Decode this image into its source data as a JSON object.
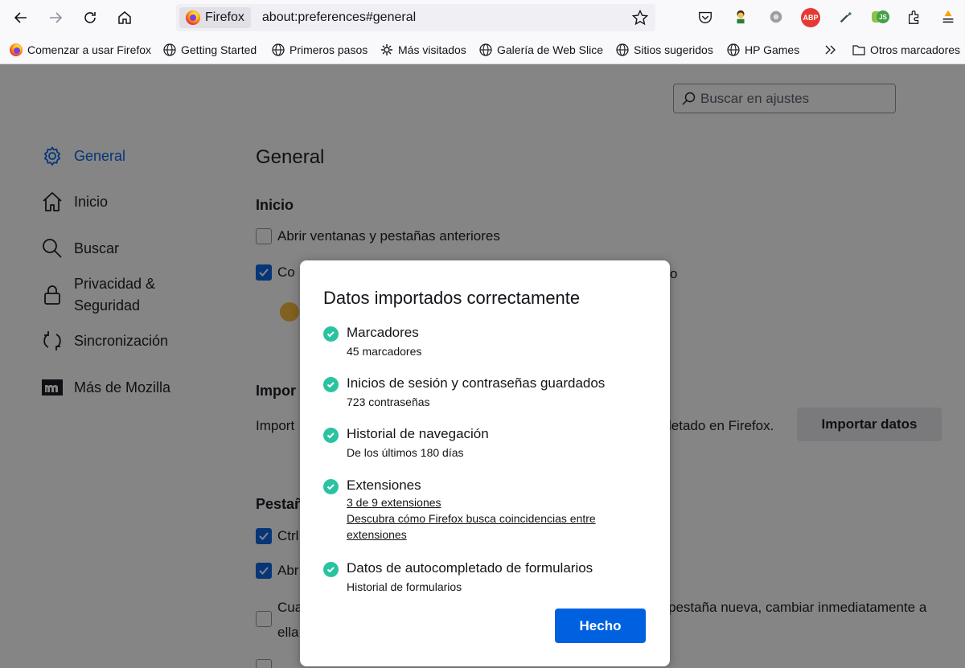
{
  "browser": {
    "identity_label": "Firefox",
    "url": "about:preferences#general"
  },
  "bookmarks": [
    {
      "label": "Comenzar a usar Firefox",
      "icon": "firefox-icon"
    },
    {
      "label": "Getting Started",
      "icon": "globe-icon"
    },
    {
      "label": "Primeros pasos",
      "icon": "globe-icon"
    },
    {
      "label": "Más visitados",
      "icon": "gear-icon"
    },
    {
      "label": "Galería de Web Slice",
      "icon": "globe-icon"
    },
    {
      "label": "Sitios sugeridos",
      "icon": "globe-icon"
    },
    {
      "label": "HP Games",
      "icon": "globe-icon"
    },
    {
      "label": "Otros marcadores",
      "icon": "folder-icon"
    }
  ],
  "toolbar_icons": {
    "abp": "ABP",
    "js": "JS"
  },
  "search": {
    "placeholder": "Buscar en ajustes"
  },
  "sidebar": {
    "items": [
      {
        "label": "General",
        "icon": "gear-icon"
      },
      {
        "label": "Inicio",
        "icon": "home-icon"
      },
      {
        "label": "Buscar",
        "icon": "search-icon"
      },
      {
        "label_line1": "Privacidad &",
        "label_line2": "Seguridad",
        "icon": "lock-icon"
      },
      {
        "label": "Sincronización",
        "icon": "sync-icon"
      },
      {
        "label": "Más de Mozilla",
        "icon": "mozilla-icon"
      }
    ]
  },
  "pane": {
    "title": "General",
    "inicio_heading": "Inicio",
    "restore_label": "Abrir ventanas y pestañas anteriores",
    "partial_checkbox_text": "Co",
    "partial_right_text": "o",
    "import_heading": "Impor",
    "import_text_left": "Import",
    "import_text_right": "letado en Firefox.",
    "import_button": "Importar datos",
    "tabs_heading": "Pestañ",
    "ctrl_text": "Ctrl",
    "abr_text": "Abr",
    "cua_text": "Cua",
    "ella_text": "ella",
    "switch_text": "pestaña nueva, cambiar inmediatamente a"
  },
  "dialog": {
    "title": "Datos importados correctamente",
    "items": [
      {
        "title": "Marcadores",
        "sub": "45 marcadores"
      },
      {
        "title": "Inicios de sesión y contraseñas guardados",
        "sub": "723 contraseñas"
      },
      {
        "title": "Historial de navegación",
        "sub": "De los últimos 180 días"
      },
      {
        "title": "Extensiones",
        "link1": "3 de 9 extensiones",
        "link2_line1": "Descubra cómo Firefox busca coincidencias entre",
        "link2_line2": "extensiones"
      },
      {
        "title": "Datos de autocompletado de formularios",
        "sub": "Historial de formularios"
      }
    ],
    "done_button": "Hecho"
  }
}
